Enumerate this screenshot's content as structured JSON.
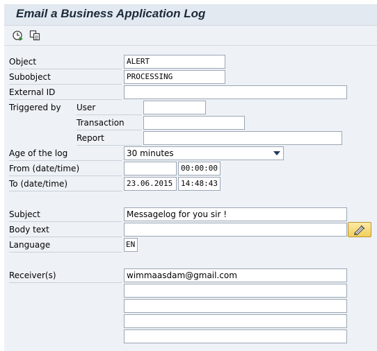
{
  "window": {
    "title": "Email a Business Application Log"
  },
  "toolbar": {
    "execute_icon": "clock-execute-icon",
    "copy_icon": "copy-icon"
  },
  "form": {
    "object": {
      "label": "Object",
      "value": "ALERT"
    },
    "subobject": {
      "label": "Subobject",
      "value": "PROCESSING"
    },
    "external_id": {
      "label": "External ID",
      "value": ""
    },
    "triggered_by": {
      "label": "Triggered by",
      "user": {
        "label": "User",
        "value": ""
      },
      "transaction": {
        "label": "Transaction",
        "value": ""
      },
      "report": {
        "label": "Report",
        "value": ""
      }
    },
    "age_of_log": {
      "label": "Age of the log",
      "value": "30 minutes"
    },
    "from": {
      "label": "From (date/time)",
      "date": "",
      "time": "00:00:00"
    },
    "to": {
      "label": "To (date/time)",
      "date": "23.06.2015",
      "time": "14:48:43"
    },
    "subject": {
      "label": "Subject",
      "value": "Messagelog for you sir !"
    },
    "body_text": {
      "label": "Body text",
      "value": "",
      "edit_icon": "pencil-edit-icon"
    },
    "language": {
      "label": "Language",
      "value": "EN"
    },
    "receivers": {
      "label": "Receiver(s)",
      "values": [
        "wimmaasdam@gmail.com",
        "",
        "",
        "",
        ""
      ]
    }
  }
}
